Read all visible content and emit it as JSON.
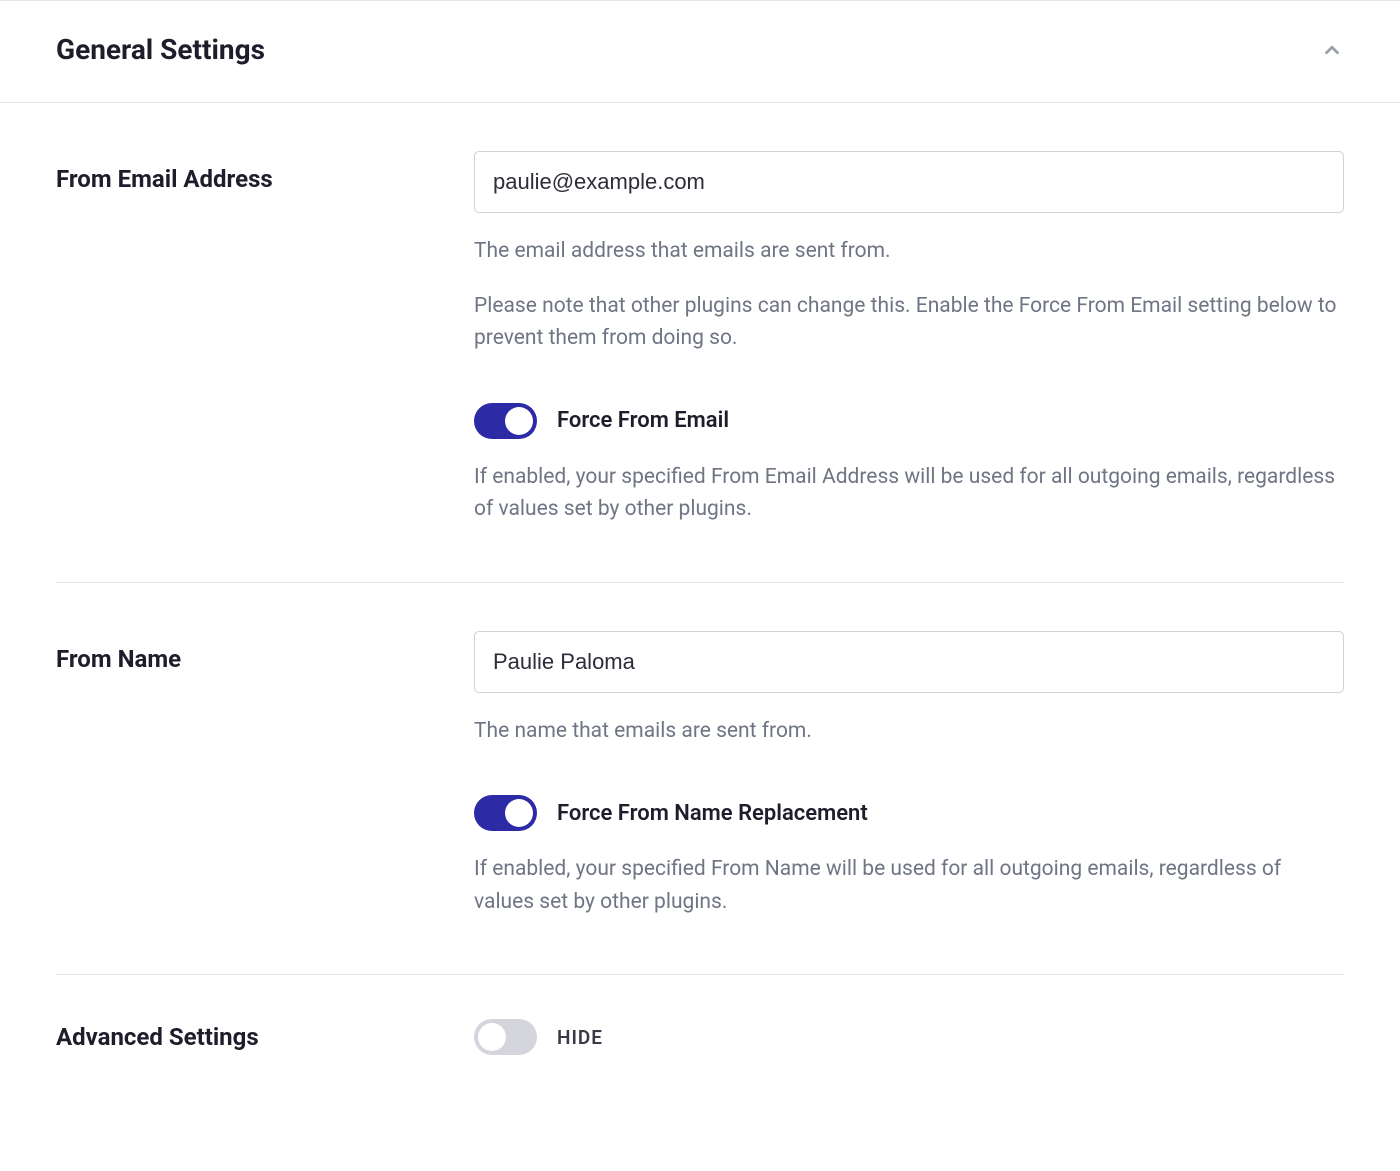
{
  "panel": {
    "title": "General Settings"
  },
  "fromEmail": {
    "label": "From Email Address",
    "value": "paulie@example.com",
    "help1": "The email address that emails are sent from.",
    "help2": "Please note that other plugins can change this. Enable the Force From Email setting below to prevent them from doing so.",
    "toggleLabel": "Force From Email",
    "toggleHelp": "If enabled, your specified From Email Address will be used for all outgoing emails, regardless of values set by other plugins."
  },
  "fromName": {
    "label": "From Name",
    "value": "Paulie Paloma",
    "help1": "The name that emails are sent from.",
    "toggleLabel": "Force From Name Replacement",
    "toggleHelp": "If enabled, your specified From Name will be used for all outgoing emails, regardless of values set by other plugins."
  },
  "advanced": {
    "label": "Advanced Settings",
    "toggleLabel": "HIDE"
  }
}
